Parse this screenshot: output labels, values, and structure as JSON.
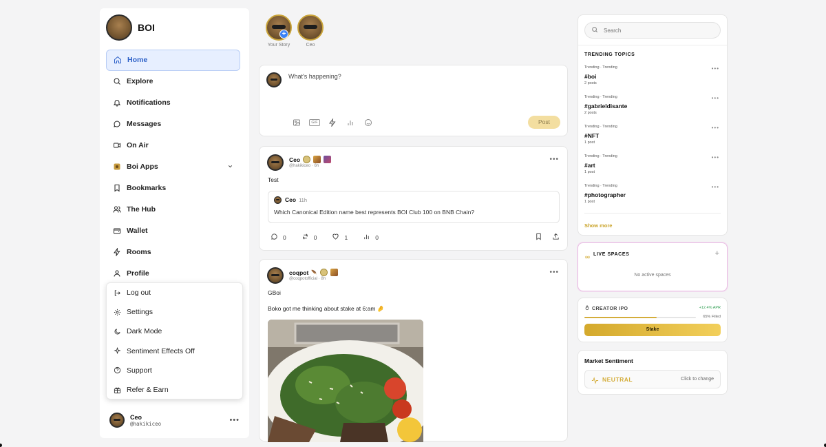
{
  "sidebar": {
    "brand": "BOI",
    "nav": [
      {
        "label": "Home",
        "icon": "home-icon"
      },
      {
        "label": "Explore",
        "icon": "search-icon"
      },
      {
        "label": "Notifications",
        "icon": "bell-icon"
      },
      {
        "label": "Messages",
        "icon": "chat-bubble-icon"
      },
      {
        "label": "On Air",
        "icon": "video-icon"
      },
      {
        "label": "Boi Apps",
        "icon": "apps-icon"
      },
      {
        "label": "Bookmarks",
        "icon": "bookmark-icon"
      },
      {
        "label": "The Hub",
        "icon": "users-icon"
      },
      {
        "label": "Wallet",
        "icon": "wallet-icon"
      },
      {
        "label": "Rooms",
        "icon": "lightning-icon"
      },
      {
        "label": "Profile",
        "icon": "user-icon"
      }
    ],
    "menu": [
      {
        "label": "Log out",
        "icon": "logout-icon"
      },
      {
        "label": "Settings",
        "icon": "gear-icon"
      },
      {
        "label": "Dark Mode",
        "icon": "moon-icon"
      },
      {
        "label": "Sentiment Effects Off",
        "icon": "sparkle-icon"
      },
      {
        "label": "Support",
        "icon": "help-icon"
      },
      {
        "label": "Refer & Earn",
        "icon": "gift-icon"
      }
    ],
    "user": {
      "name": "Ceo",
      "handle": "@hakikiceo"
    }
  },
  "stories": [
    {
      "label": "Your Story"
    },
    {
      "label": "Ceo"
    }
  ],
  "composer": {
    "placeholder": "What's happening?",
    "post_label": "Post",
    "gif_label": "GIF"
  },
  "posts": [
    {
      "author": "Ceo",
      "handle": "@hakikiceo",
      "time": "6h",
      "text": "Test",
      "quote": {
        "author": "Ceo",
        "time": "11h",
        "text": "Which Canonical Edition name best represents BOI Club 100 on BNB Chain?"
      },
      "comments": "0",
      "reposts": "0",
      "likes": "1",
      "views": "0"
    },
    {
      "author": "coqpot",
      "handle": "@coqpotofficial",
      "time": "8h",
      "text": "GBoi",
      "text2": "Boko got me thinking about stake at 6:am 🤌"
    }
  ],
  "search": {
    "placeholder": "Search"
  },
  "trending": {
    "title": "TRENDING TOPICS",
    "meta": "Trending · Trending",
    "topics": [
      {
        "tag": "#boi",
        "count": "2 posts"
      },
      {
        "tag": "#gabrieldisante",
        "count": "2 posts"
      },
      {
        "tag": "#NFT",
        "count": "1 post"
      },
      {
        "tag": "#art",
        "count": "1 post"
      },
      {
        "tag": "#photographer",
        "count": "1 post"
      }
    ],
    "show_more": "Show more"
  },
  "spaces": {
    "title": "LIVE SPACES",
    "empty": "No active spaces"
  },
  "ipo": {
    "title": "CREATOR IPO",
    "apr": "+12.4% APR",
    "filled": "65% Filled",
    "progress": 0.65,
    "button": "Stake"
  },
  "sentiment": {
    "title": "Market Sentiment",
    "value": "NEUTRAL",
    "change": "Click to change"
  },
  "colors": {
    "accent": "#d4ad3a",
    "active_nav": "#2b5fc7",
    "live": "#e9c1e5"
  }
}
